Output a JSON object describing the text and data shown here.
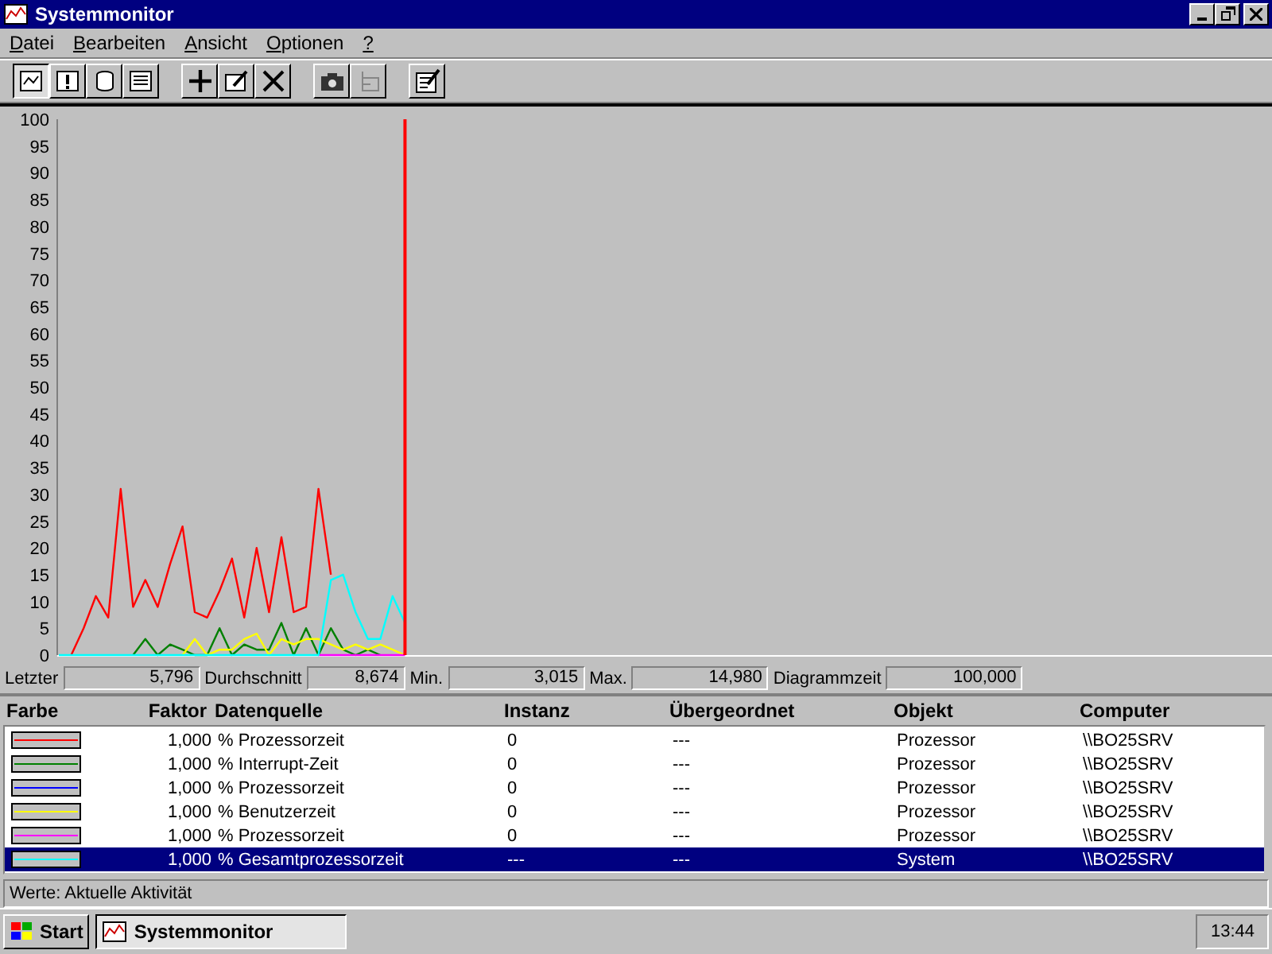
{
  "window": {
    "title": "Systemmonitor"
  },
  "menu": [
    {
      "label": "Datei"
    },
    {
      "label": "Bearbeiten"
    },
    {
      "label": "Ansicht"
    },
    {
      "label": "Optionen"
    },
    {
      "label": "?"
    }
  ],
  "toolbar": {
    "views": [
      {
        "selected": true
      },
      {
        "selected": false
      },
      {
        "selected": false
      },
      {
        "selected": false
      }
    ],
    "actions": [
      {
        "disabled": false
      },
      {
        "disabled": false
      },
      {
        "disabled": false
      }
    ],
    "tools": [
      {
        "disabled": false
      },
      {
        "disabled": true
      }
    ],
    "extra": [
      {
        "disabled": false
      }
    ]
  },
  "chart": {
    "chart_data": {
      "type": "line",
      "categories": [
        null,
        null,
        null,
        null,
        null,
        null,
        null,
        null,
        null,
        null,
        null,
        null,
        null,
        null,
        null,
        null,
        null,
        null,
        null,
        null,
        null,
        null,
        null,
        null,
        null,
        null,
        null,
        null,
        null,
        null,
        null,
        null,
        null,
        null,
        null,
        null,
        null,
        null,
        null,
        null,
        null,
        null,
        null,
        null,
        null,
        null,
        null,
        null,
        null,
        null,
        null,
        null,
        null,
        null,
        null,
        null,
        null,
        null,
        null,
        null,
        null,
        null,
        null,
        null,
        null,
        null,
        null,
        null,
        null,
        null,
        null,
        null,
        null,
        null,
        null,
        null,
        null,
        null,
        null,
        null,
        null,
        null,
        null,
        null,
        null,
        null,
        null,
        null,
        null,
        null,
        null,
        null,
        null,
        null,
        null,
        null,
        null,
        null,
        null
      ],
      "ylim": [
        0,
        100
      ],
      "yticks": [
        0,
        5,
        10,
        15,
        20,
        25,
        30,
        35,
        40,
        45,
        50,
        55,
        60,
        65,
        70,
        75,
        80,
        85,
        90,
        95,
        100
      ],
      "series": [
        {
          "color": "#ff0000",
          "values": [
            null,
            0,
            5,
            11,
            7,
            31,
            9,
            14,
            9,
            17,
            24,
            8,
            7,
            12,
            18,
            7,
            20,
            8,
            22,
            8,
            9,
            31,
            15,
            null,
            null,
            null,
            null,
            null,
            null,
            null,
            null,
            null,
            null,
            null,
            null,
            null,
            null,
            null,
            null,
            null,
            null,
            null,
            null,
            null,
            null,
            null,
            null,
            null,
            null,
            null,
            null,
            null,
            null,
            null,
            null,
            null,
            null,
            null,
            null,
            null,
            null,
            null,
            null,
            null,
            null,
            null,
            null,
            null,
            null,
            null,
            null,
            null,
            null,
            null,
            null,
            null,
            null,
            null,
            null,
            null,
            null,
            null,
            null,
            null,
            null,
            null,
            null,
            null,
            null,
            null,
            null,
            null,
            null,
            null,
            null,
            null,
            null,
            null,
            null
          ]
        },
        {
          "color": "#008000",
          "values": [
            null,
            null,
            null,
            null,
            null,
            null,
            0,
            3,
            0,
            2,
            1,
            0,
            0,
            5,
            0,
            2,
            1,
            1,
            6,
            0,
            5,
            0,
            5,
            1,
            0,
            1,
            0,
            null,
            null,
            null,
            null,
            null,
            null,
            null,
            null,
            null,
            null,
            null,
            null,
            null,
            null,
            null,
            null,
            null,
            null,
            null,
            null,
            null,
            null,
            null,
            null,
            null,
            null,
            null,
            null,
            null,
            null,
            null,
            null,
            null,
            null,
            null,
            null,
            null,
            null,
            null,
            null,
            null,
            null,
            null,
            null,
            null,
            null,
            null,
            null,
            null,
            null,
            null,
            null,
            null,
            null,
            null,
            null,
            null,
            null,
            null,
            null,
            null,
            null,
            null,
            null,
            null,
            null,
            null,
            null,
            null,
            null,
            null,
            null
          ]
        },
        {
          "color": "#ffff00",
          "values": [
            null,
            null,
            null,
            null,
            null,
            null,
            null,
            null,
            null,
            null,
            0,
            3,
            0,
            1,
            1,
            3,
            4,
            0,
            3,
            2,
            3,
            3,
            2,
            1,
            2,
            1,
            2,
            1,
            0,
            null,
            null,
            null,
            null,
            null,
            null,
            null,
            null,
            null,
            null,
            null,
            null,
            null,
            null,
            null,
            null,
            null,
            null,
            null,
            null,
            null,
            null,
            null,
            null,
            null,
            null,
            null,
            null,
            null,
            null,
            null,
            null,
            null,
            null,
            null,
            null,
            null,
            null,
            null,
            null,
            null,
            null,
            null,
            null,
            null,
            null,
            null,
            null,
            null,
            null,
            null,
            null,
            null,
            null,
            null,
            null,
            null,
            null,
            null,
            null,
            null,
            null,
            null,
            null,
            null,
            null,
            null,
            null,
            null,
            null
          ]
        },
        {
          "color": "#ff00ff",
          "values": [
            null,
            null,
            null,
            null,
            null,
            null,
            null,
            null,
            null,
            null,
            null,
            null,
            null,
            null,
            null,
            null,
            null,
            null,
            null,
            null,
            null,
            0,
            0,
            0,
            0,
            0,
            0,
            0,
            0,
            null,
            null,
            null,
            null,
            null,
            null,
            null,
            null,
            null,
            null,
            null,
            null,
            null,
            null,
            null,
            null,
            null,
            null,
            null,
            null,
            null,
            null,
            null,
            null,
            null,
            null,
            null,
            null,
            null,
            null,
            null,
            null,
            null,
            null,
            null,
            null,
            null,
            null,
            null,
            null,
            null,
            null,
            null,
            null,
            null,
            null,
            null,
            null,
            null,
            null,
            null,
            null,
            null,
            null,
            null,
            null,
            null,
            null,
            null,
            null,
            null,
            null,
            null,
            null,
            null,
            null,
            null,
            null,
            null,
            null
          ]
        },
        {
          "color": "#00ffff",
          "values": [
            0,
            0,
            0,
            0,
            0,
            0,
            0,
            0,
            0,
            0,
            0,
            0,
            0,
            0,
            0,
            0,
            0,
            0,
            0,
            0,
            0,
            0,
            14,
            15,
            8,
            3,
            3,
            11,
            6,
            null,
            null,
            null,
            null,
            null,
            null,
            null,
            null,
            null,
            null,
            null,
            null,
            null,
            null,
            null,
            null,
            null,
            null,
            null,
            null,
            null,
            null,
            null,
            null,
            null,
            null,
            null,
            null,
            null,
            null,
            null,
            null,
            null,
            null,
            null,
            null,
            null,
            null,
            null,
            null,
            null,
            null,
            null,
            null,
            null,
            null,
            null,
            null,
            null,
            null,
            null,
            null,
            null,
            null,
            null,
            null,
            null,
            null,
            null,
            null,
            null,
            null,
            null,
            null,
            null,
            null,
            null,
            null,
            null,
            null
          ]
        }
      ]
    }
  },
  "stats": [
    {
      "label": "Letzter",
      "value": "5,796"
    },
    {
      "label": "Durchschnitt",
      "value": "8,674"
    },
    {
      "label": "Min.",
      "value": "3,015"
    },
    {
      "label": "Max.",
      "value": "14,980"
    },
    {
      "label": "Diagrammzeit",
      "value": "100,000"
    }
  ],
  "table": {
    "columns": [
      "Farbe",
      "Faktor",
      "Datenquelle",
      "Instanz",
      "Übergeordnet",
      "Objekt",
      "Computer"
    ],
    "rows": [
      {
        "color": "#ff0000",
        "factor": "1,000",
        "source": "% Prozessorzeit",
        "instance": "0",
        "parent": "---",
        "object": "Prozessor",
        "computer": "\\\\BO25SRV",
        "selected": false
      },
      {
        "color": "#008000",
        "factor": "1,000",
        "source": "% Interrupt-Zeit",
        "instance": "0",
        "parent": "---",
        "object": "Prozessor",
        "computer": "\\\\BO25SRV",
        "selected": false
      },
      {
        "color": "#0000ff",
        "factor": "1,000",
        "source": "% Prozessorzeit",
        "instance": "0",
        "parent": "---",
        "object": "Prozessor",
        "computer": "\\\\BO25SRV",
        "selected": false
      },
      {
        "color": "#ffff00",
        "factor": "1,000",
        "source": "% Benutzerzeit",
        "instance": "0",
        "parent": "---",
        "object": "Prozessor",
        "computer": "\\\\BO25SRV",
        "selected": false
      },
      {
        "color": "#ff00ff",
        "factor": "1,000",
        "source": "% Prozessorzeit",
        "instance": "0",
        "parent": "---",
        "object": "Prozessor",
        "computer": "\\\\BO25SRV",
        "selected": false
      },
      {
        "color": "#00ffff",
        "factor": "1,000",
        "source": "% Gesamtprozessorzeit",
        "instance": "---",
        "parent": "---",
        "object": "System",
        "computer": "\\\\BO25SRV",
        "selected": true
      }
    ]
  },
  "status_bar": "Werte: Aktuelle Aktivität",
  "taskbar": {
    "start": "Start",
    "tasks": [
      {
        "label": "Systemmonitor",
        "selected": true
      }
    ],
    "clock": "13:44"
  }
}
